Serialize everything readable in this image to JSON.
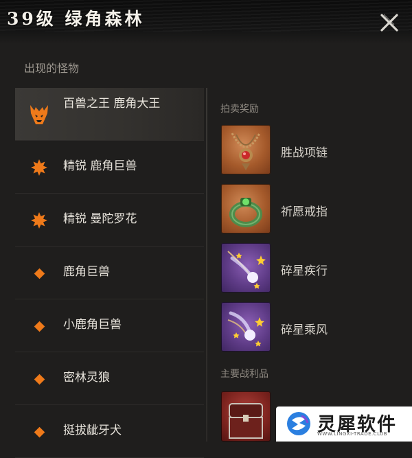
{
  "header": {
    "title": "39级 绿角森林"
  },
  "monsters_section": {
    "label": "出现的怪物",
    "items": [
      {
        "name": "百兽之王 鹿角大王",
        "icon": "boss-demon-icon",
        "active": true
      },
      {
        "name": "精锐 鹿角巨兽",
        "icon": "elite-burst-icon"
      },
      {
        "name": "精锐 曼陀罗花",
        "icon": "elite-burst-icon"
      },
      {
        "name": "鹿角巨兽",
        "icon": "normal-diamond-icon"
      },
      {
        "name": "小鹿角巨兽",
        "icon": "normal-diamond-icon"
      },
      {
        "name": "密林灵狼",
        "icon": "normal-diamond-icon"
      },
      {
        "name": "挺拔龇牙犬",
        "icon": "normal-diamond-icon"
      }
    ]
  },
  "auction_section": {
    "label": "拍卖奖励",
    "items": [
      {
        "name": "胜战项链",
        "icon": "necklace-icon",
        "rarity_color": "#a55a2b"
      },
      {
        "name": "祈愿戒指",
        "icon": "ring-icon",
        "rarity_color": "#a55a2b"
      },
      {
        "name": "碎星疾行",
        "icon": "shooting-star-icon",
        "rarity_color": "#5e3b86"
      },
      {
        "name": "碎星乘风",
        "icon": "shooting-star-icon",
        "rarity_color": "#5e3b86"
      }
    ]
  },
  "loot_section": {
    "label": "主要战利品",
    "items": [
      {
        "icon": "chest-icon"
      }
    ]
  },
  "watermark": {
    "text": "灵犀软件",
    "url": "WWW.LINGXI-TRADE.CLUB"
  },
  "colors": {
    "accent": "#ef7a1a",
    "background": "#1f1e1d"
  }
}
